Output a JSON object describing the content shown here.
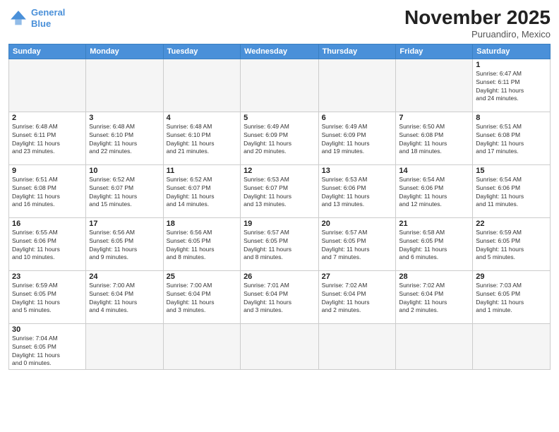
{
  "header": {
    "logo_line1": "General",
    "logo_line2": "Blue",
    "month_title": "November 2025",
    "location": "Puruandiro, Mexico"
  },
  "weekdays": [
    "Sunday",
    "Monday",
    "Tuesday",
    "Wednesday",
    "Thursday",
    "Friday",
    "Saturday"
  ],
  "weeks": [
    [
      {
        "day": "",
        "info": ""
      },
      {
        "day": "",
        "info": ""
      },
      {
        "day": "",
        "info": ""
      },
      {
        "day": "",
        "info": ""
      },
      {
        "day": "",
        "info": ""
      },
      {
        "day": "",
        "info": ""
      },
      {
        "day": "1",
        "info": "Sunrise: 6:47 AM\nSunset: 6:11 PM\nDaylight: 11 hours\nand 24 minutes."
      }
    ],
    [
      {
        "day": "2",
        "info": "Sunrise: 6:48 AM\nSunset: 6:11 PM\nDaylight: 11 hours\nand 23 minutes."
      },
      {
        "day": "3",
        "info": "Sunrise: 6:48 AM\nSunset: 6:10 PM\nDaylight: 11 hours\nand 22 minutes."
      },
      {
        "day": "4",
        "info": "Sunrise: 6:48 AM\nSunset: 6:10 PM\nDaylight: 11 hours\nand 21 minutes."
      },
      {
        "day": "5",
        "info": "Sunrise: 6:49 AM\nSunset: 6:09 PM\nDaylight: 11 hours\nand 20 minutes."
      },
      {
        "day": "6",
        "info": "Sunrise: 6:49 AM\nSunset: 6:09 PM\nDaylight: 11 hours\nand 19 minutes."
      },
      {
        "day": "7",
        "info": "Sunrise: 6:50 AM\nSunset: 6:08 PM\nDaylight: 11 hours\nand 18 minutes."
      },
      {
        "day": "8",
        "info": "Sunrise: 6:51 AM\nSunset: 6:08 PM\nDaylight: 11 hours\nand 17 minutes."
      }
    ],
    [
      {
        "day": "9",
        "info": "Sunrise: 6:51 AM\nSunset: 6:08 PM\nDaylight: 11 hours\nand 16 minutes."
      },
      {
        "day": "10",
        "info": "Sunrise: 6:52 AM\nSunset: 6:07 PM\nDaylight: 11 hours\nand 15 minutes."
      },
      {
        "day": "11",
        "info": "Sunrise: 6:52 AM\nSunset: 6:07 PM\nDaylight: 11 hours\nand 14 minutes."
      },
      {
        "day": "12",
        "info": "Sunrise: 6:53 AM\nSunset: 6:07 PM\nDaylight: 11 hours\nand 13 minutes."
      },
      {
        "day": "13",
        "info": "Sunrise: 6:53 AM\nSunset: 6:06 PM\nDaylight: 11 hours\nand 13 minutes."
      },
      {
        "day": "14",
        "info": "Sunrise: 6:54 AM\nSunset: 6:06 PM\nDaylight: 11 hours\nand 12 minutes."
      },
      {
        "day": "15",
        "info": "Sunrise: 6:54 AM\nSunset: 6:06 PM\nDaylight: 11 hours\nand 11 minutes."
      }
    ],
    [
      {
        "day": "16",
        "info": "Sunrise: 6:55 AM\nSunset: 6:06 PM\nDaylight: 11 hours\nand 10 minutes."
      },
      {
        "day": "17",
        "info": "Sunrise: 6:56 AM\nSunset: 6:05 PM\nDaylight: 11 hours\nand 9 minutes."
      },
      {
        "day": "18",
        "info": "Sunrise: 6:56 AM\nSunset: 6:05 PM\nDaylight: 11 hours\nand 8 minutes."
      },
      {
        "day": "19",
        "info": "Sunrise: 6:57 AM\nSunset: 6:05 PM\nDaylight: 11 hours\nand 8 minutes."
      },
      {
        "day": "20",
        "info": "Sunrise: 6:57 AM\nSunset: 6:05 PM\nDaylight: 11 hours\nand 7 minutes."
      },
      {
        "day": "21",
        "info": "Sunrise: 6:58 AM\nSunset: 6:05 PM\nDaylight: 11 hours\nand 6 minutes."
      },
      {
        "day": "22",
        "info": "Sunrise: 6:59 AM\nSunset: 6:05 PM\nDaylight: 11 hours\nand 5 minutes."
      }
    ],
    [
      {
        "day": "23",
        "info": "Sunrise: 6:59 AM\nSunset: 6:05 PM\nDaylight: 11 hours\nand 5 minutes."
      },
      {
        "day": "24",
        "info": "Sunrise: 7:00 AM\nSunset: 6:04 PM\nDaylight: 11 hours\nand 4 minutes."
      },
      {
        "day": "25",
        "info": "Sunrise: 7:00 AM\nSunset: 6:04 PM\nDaylight: 11 hours\nand 3 minutes."
      },
      {
        "day": "26",
        "info": "Sunrise: 7:01 AM\nSunset: 6:04 PM\nDaylight: 11 hours\nand 3 minutes."
      },
      {
        "day": "27",
        "info": "Sunrise: 7:02 AM\nSunset: 6:04 PM\nDaylight: 11 hours\nand 2 minutes."
      },
      {
        "day": "28",
        "info": "Sunrise: 7:02 AM\nSunset: 6:04 PM\nDaylight: 11 hours\nand 2 minutes."
      },
      {
        "day": "29",
        "info": "Sunrise: 7:03 AM\nSunset: 6:05 PM\nDaylight: 11 hours\nand 1 minute."
      }
    ],
    [
      {
        "day": "30",
        "info": "Sunrise: 7:04 AM\nSunset: 6:05 PM\nDaylight: 11 hours\nand 0 minutes."
      },
      {
        "day": "",
        "info": ""
      },
      {
        "day": "",
        "info": ""
      },
      {
        "day": "",
        "info": ""
      },
      {
        "day": "",
        "info": ""
      },
      {
        "day": "",
        "info": ""
      },
      {
        "day": "",
        "info": ""
      }
    ]
  ]
}
